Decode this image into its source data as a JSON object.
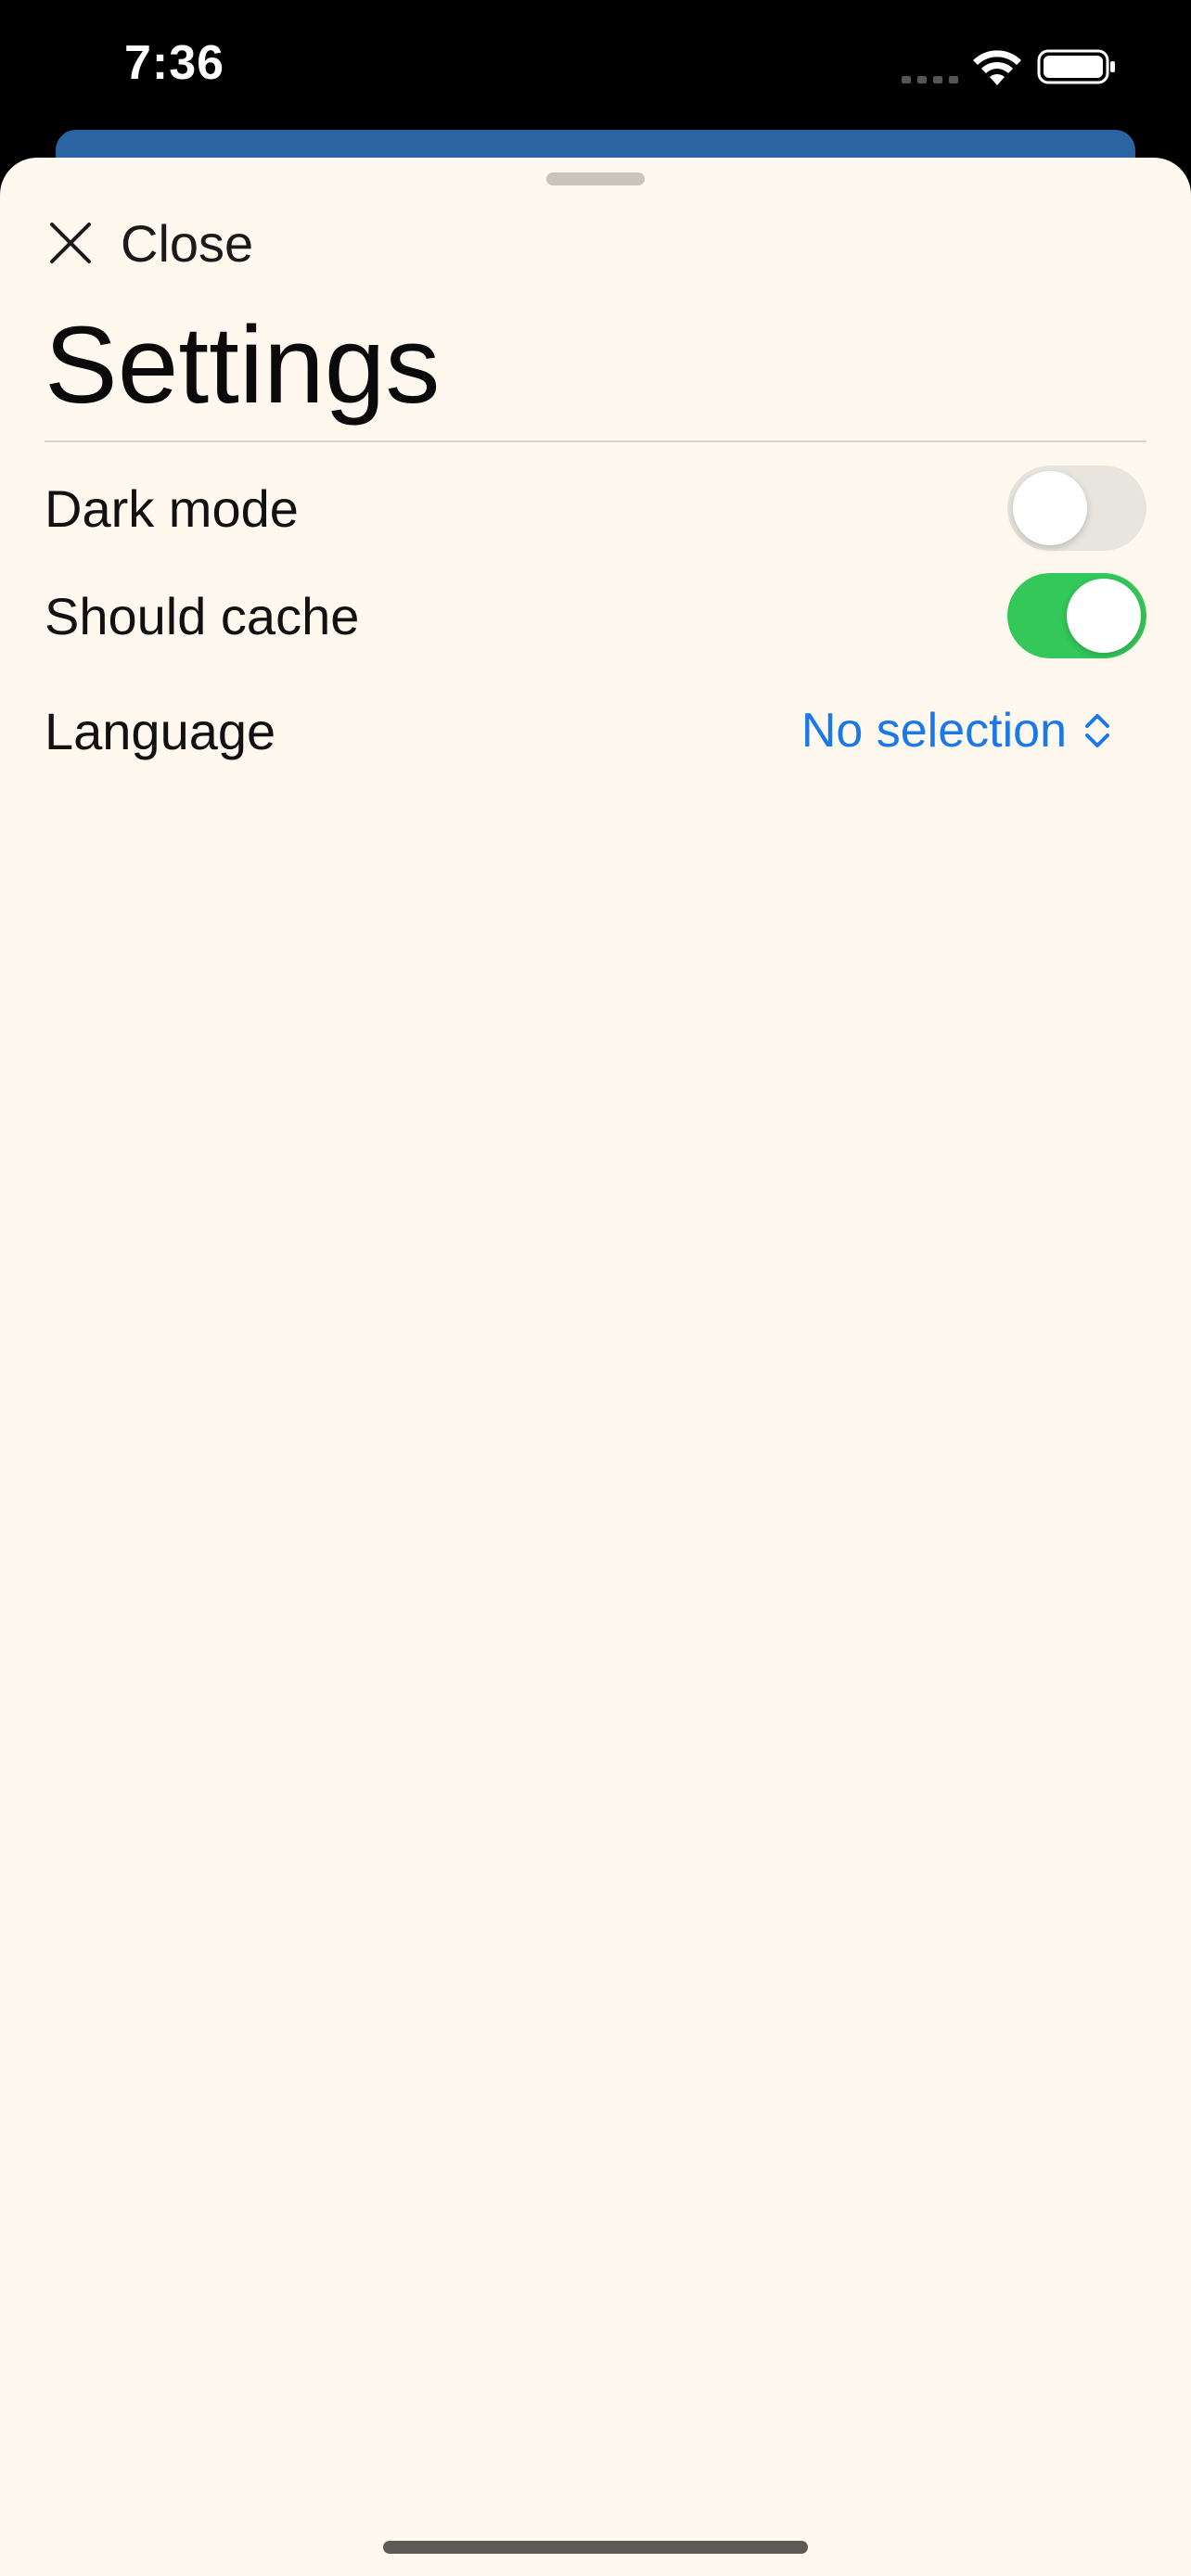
{
  "status_bar": {
    "time": "7:36",
    "icons": [
      "cellular-signal-icon",
      "wifi-icon",
      "battery-icon"
    ]
  },
  "sheet": {
    "close_label": "Close",
    "close_icon": "close-icon",
    "title": "Settings",
    "settings": [
      {
        "label": "Dark mode",
        "type": "toggle",
        "value": false
      },
      {
        "label": "Should cache",
        "type": "toggle",
        "value": true
      },
      {
        "label": "Language",
        "type": "picker",
        "value": "No selection",
        "icon": "chevron-updown-icon"
      }
    ]
  },
  "colors": {
    "sheet_background": "#fff8ef",
    "underlying_card": "#2b64a3",
    "toggle_on": "#34c759",
    "toggle_off": "#e8e4de",
    "accent": "#1a78e8"
  }
}
